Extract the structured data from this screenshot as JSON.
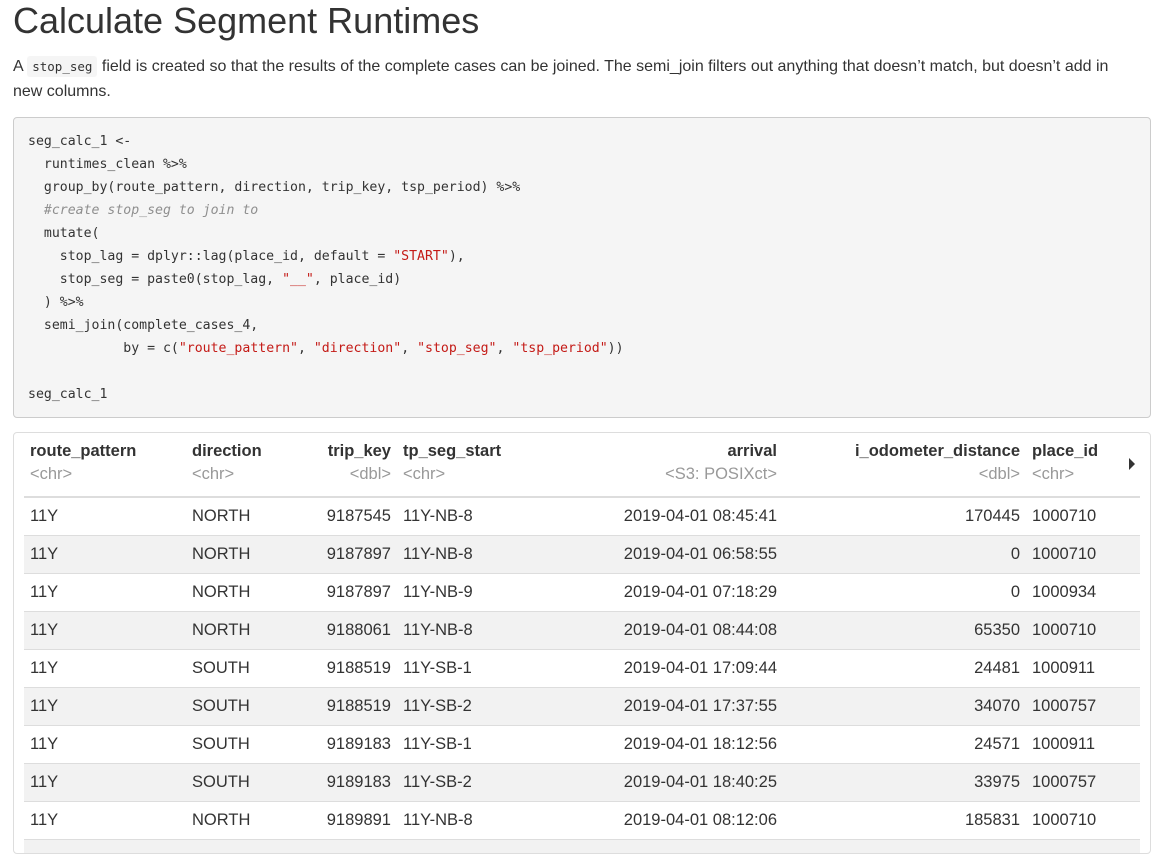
{
  "title": "Calculate Segment Runtimes",
  "intro": {
    "before": "A ",
    "code": "stop_seg",
    "after": " field is created so that the results of the complete cases can be joined. The semi_join filters out anything that doesn’t match, but doesn’t add in new columns."
  },
  "code_lines": [
    [
      {
        "t": "seg_calc_1 <-"
      }
    ],
    [
      {
        "t": "  runtimes_clean %>%"
      }
    ],
    [
      {
        "t": "  group_by(route_pattern, direction, trip_key, tsp_period) %>%"
      }
    ],
    [
      {
        "t": "  #create stop_seg to join to",
        "c": "cmt"
      }
    ],
    [
      {
        "t": "  mutate("
      }
    ],
    [
      {
        "t": "    stop_lag = dplyr::lag(place_id, default = "
      },
      {
        "t": "\"START\"",
        "c": "str"
      },
      {
        "t": "),"
      }
    ],
    [
      {
        "t": "    stop_seg = paste0(stop_lag, "
      },
      {
        "t": "\"__\"",
        "c": "str"
      },
      {
        "t": ", place_id)"
      }
    ],
    [
      {
        "t": "  ) %>%"
      }
    ],
    [
      {
        "t": "  semi_join(complete_cases_4,"
      }
    ],
    [
      {
        "t": "            by = c("
      },
      {
        "t": "\"route_pattern\"",
        "c": "str"
      },
      {
        "t": ", "
      },
      {
        "t": "\"direction\"",
        "c": "str"
      },
      {
        "t": ", "
      },
      {
        "t": "\"stop_seg\"",
        "c": "str"
      },
      {
        "t": ", "
      },
      {
        "t": "\"tsp_period\"",
        "c": "str"
      },
      {
        "t": "))"
      }
    ],
    [
      {
        "t": ""
      }
    ],
    [
      {
        "t": "seg_calc_1"
      }
    ]
  ],
  "table": {
    "columns": [
      {
        "name": "route_pattern",
        "type": "<chr>",
        "align": "left"
      },
      {
        "name": "direction",
        "type": "<chr>",
        "align": "left"
      },
      {
        "name": "trip_key",
        "type": "<dbl>",
        "align": "right"
      },
      {
        "name": "tp_seg_start",
        "type": "<chr>",
        "align": "left"
      },
      {
        "name": "arrival",
        "type": "<S3: POSIXct>",
        "align": "right"
      },
      {
        "name": "i_odometer_distance",
        "type": "<dbl>",
        "align": "right"
      },
      {
        "name": "place_id",
        "type": "<chr>",
        "align": "left"
      }
    ],
    "rows": [
      [
        "11Y",
        "NORTH",
        "9187545",
        "11Y-NB-8",
        "2019-04-01 08:45:41",
        "170445",
        "1000710"
      ],
      [
        "11Y",
        "NORTH",
        "9187897",
        "11Y-NB-8",
        "2019-04-01 06:58:55",
        "0",
        "1000710"
      ],
      [
        "11Y",
        "NORTH",
        "9187897",
        "11Y-NB-9",
        "2019-04-01 07:18:29",
        "0",
        "1000934"
      ],
      [
        "11Y",
        "NORTH",
        "9188061",
        "11Y-NB-8",
        "2019-04-01 08:44:08",
        "65350",
        "1000710"
      ],
      [
        "11Y",
        "SOUTH",
        "9188519",
        "11Y-SB-1",
        "2019-04-01 17:09:44",
        "24481",
        "1000911"
      ],
      [
        "11Y",
        "SOUTH",
        "9188519",
        "11Y-SB-2",
        "2019-04-01 17:37:55",
        "34070",
        "1000757"
      ],
      [
        "11Y",
        "SOUTH",
        "9189183",
        "11Y-SB-1",
        "2019-04-01 18:12:56",
        "24571",
        "1000911"
      ],
      [
        "11Y",
        "SOUTH",
        "9189183",
        "11Y-SB-2",
        "2019-04-01 18:40:25",
        "33975",
        "1000757"
      ],
      [
        "11Y",
        "NORTH",
        "9189891",
        "11Y-NB-8",
        "2019-04-01 08:12:06",
        "185831",
        "1000710"
      ],
      [
        "",
        "",
        "",
        "",
        "",
        "",
        ""
      ]
    ],
    "next_columns_icon": "triangle-right-icon"
  }
}
